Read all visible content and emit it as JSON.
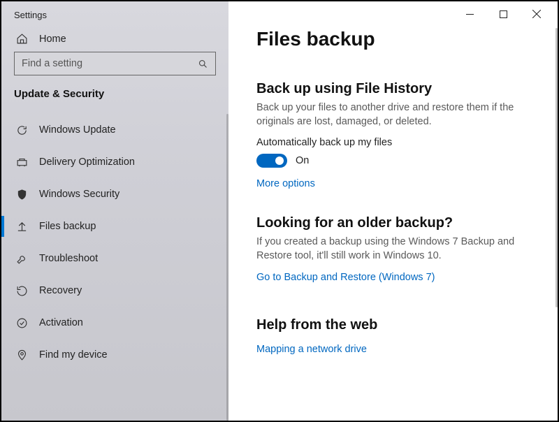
{
  "window_title": "Settings",
  "home_label": "Home",
  "search": {
    "placeholder": "Find a setting"
  },
  "section_title": "Update & Security",
  "nav": [
    {
      "label": "Windows Update",
      "icon": "sync-icon"
    },
    {
      "label": "Delivery Optimization",
      "icon": "delivery-icon"
    },
    {
      "label": "Windows Security",
      "icon": "shield-icon"
    },
    {
      "label": "Files backup",
      "icon": "backup-icon",
      "active": true
    },
    {
      "label": "Troubleshoot",
      "icon": "wrench-icon"
    },
    {
      "label": "Recovery",
      "icon": "recovery-icon"
    },
    {
      "label": "Activation",
      "icon": "activation-icon"
    },
    {
      "label": "Find my device",
      "icon": "location-icon"
    }
  ],
  "page_title": "Files backup",
  "filehistory": {
    "heading": "Back up using File History",
    "desc": "Back up your files to another drive and restore them if the originals are lost, damaged, or deleted.",
    "toggle_label": "Automatically back up my files",
    "toggle_state": "On",
    "more_options": "More options"
  },
  "older": {
    "heading": "Looking for an older backup?",
    "desc": "If you created a backup using the Windows 7 Backup and Restore tool, it'll still work in Windows 10.",
    "link": "Go to Backup and Restore (Windows 7)"
  },
  "help": {
    "heading": "Help from the web",
    "link": "Mapping a network drive"
  }
}
